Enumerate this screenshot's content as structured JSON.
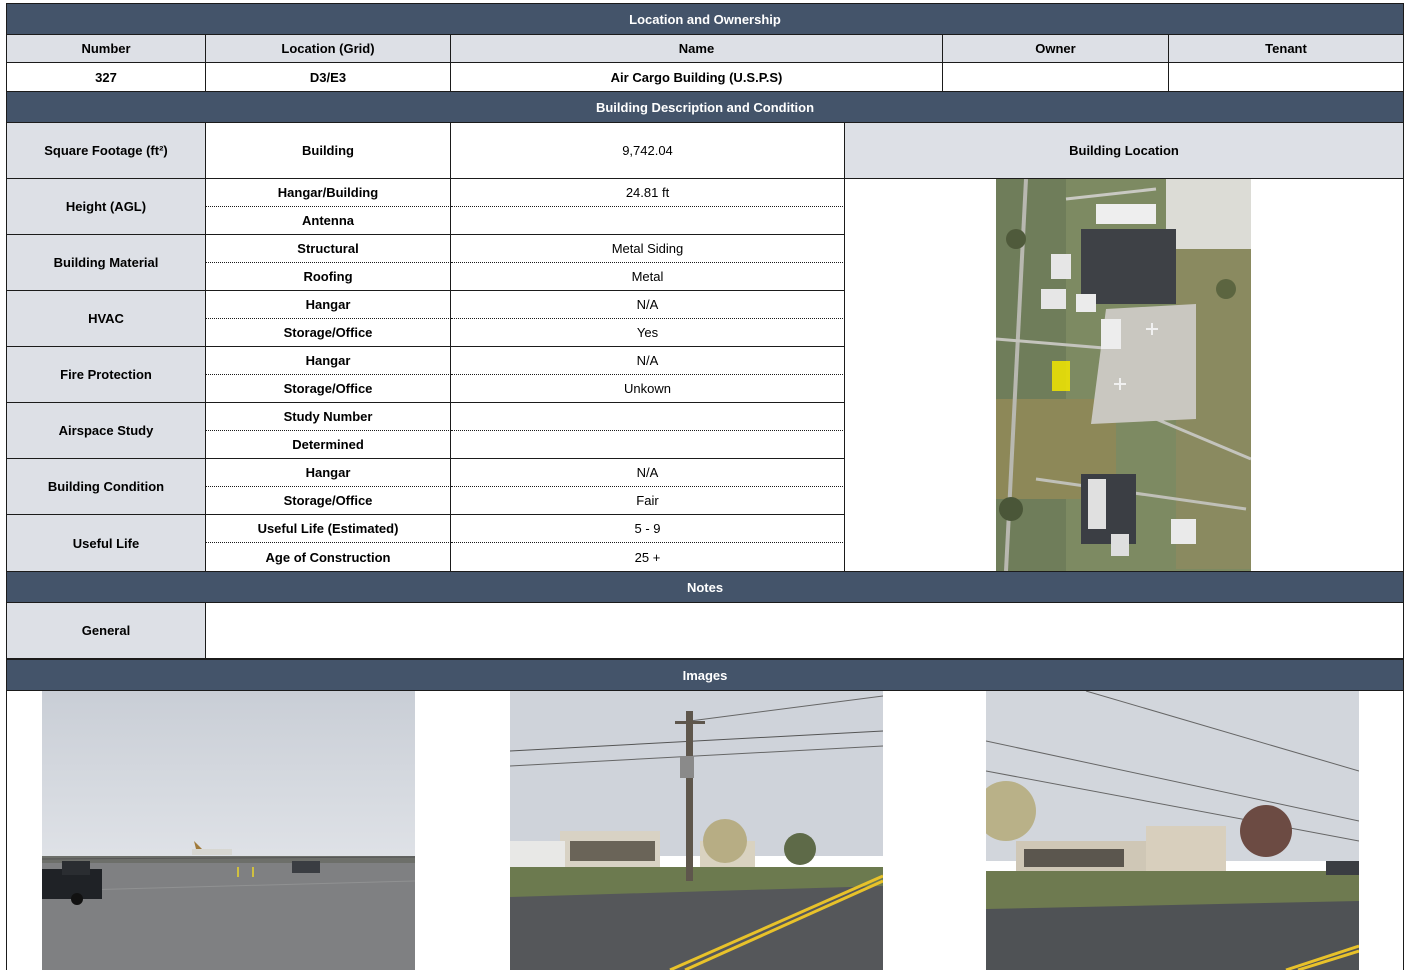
{
  "location_section": {
    "title": "Location and Ownership",
    "headers": [
      "Number",
      "Location (Grid)",
      "Name",
      "Owner",
      "Tenant"
    ],
    "values": [
      "327",
      "D3/E3",
      "Air Cargo Building (U.S.P.S)",
      "",
      ""
    ]
  },
  "description_section": {
    "title": "Building Description and Condition",
    "square_footage": {
      "label": "Square Footage (ft²)",
      "sub": "Building",
      "value": "9,742.04"
    },
    "building_location_label": "Building Location",
    "groups": [
      {
        "label": "Height (AGL)",
        "rows": [
          {
            "sub": "Hangar/Building",
            "value": "24.81 ft"
          },
          {
            "sub": "Antenna",
            "value": ""
          }
        ]
      },
      {
        "label": "Building Material",
        "rows": [
          {
            "sub": "Structural",
            "value": "Metal Siding"
          },
          {
            "sub": "Roofing",
            "value": "Metal"
          }
        ]
      },
      {
        "label": "HVAC",
        "rows": [
          {
            "sub": "Hangar",
            "value": "N/A"
          },
          {
            "sub": "Storage/Office",
            "value": "Yes"
          }
        ]
      },
      {
        "label": "Fire Protection",
        "rows": [
          {
            "sub": "Hangar",
            "value": "N/A"
          },
          {
            "sub": "Storage/Office",
            "value": "Unkown"
          }
        ]
      },
      {
        "label": "Airspace Study",
        "rows": [
          {
            "sub": "Study Number",
            "value": ""
          },
          {
            "sub": "Determined",
            "value": ""
          }
        ]
      },
      {
        "label": "Building Condition",
        "rows": [
          {
            "sub": "Hangar",
            "value": "N/A"
          },
          {
            "sub": "Storage/Office",
            "value": "Fair"
          }
        ]
      },
      {
        "label": "Useful Life",
        "rows": [
          {
            "sub": "Useful Life (Estimated)",
            "value": "5 - 9"
          },
          {
            "sub": "Age of Construction",
            "value": "25 +"
          }
        ]
      }
    ]
  },
  "notes_section": {
    "title": "Notes",
    "label": "General",
    "value": ""
  },
  "images_section": {
    "title": "Images"
  },
  "colors": {
    "header_bg": "#44546a",
    "label_bg": "#dde0e6",
    "highlight": "#f2e600"
  }
}
